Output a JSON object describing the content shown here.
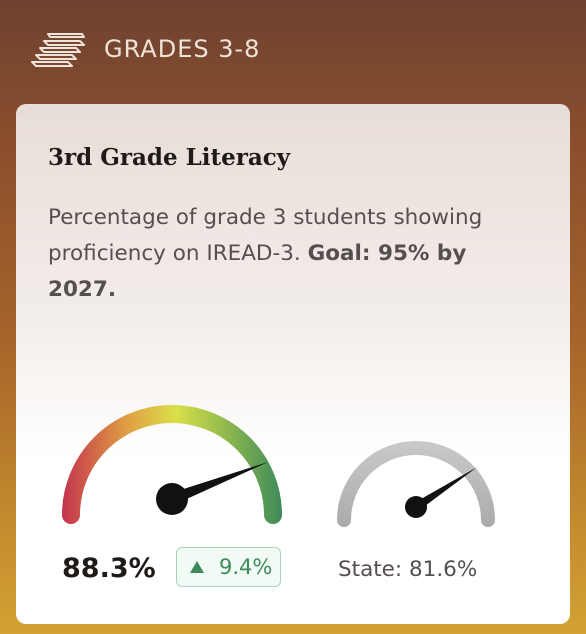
{
  "header": {
    "icon": "stairs-icon",
    "title": "GRADES 3-8"
  },
  "card": {
    "title": "3rd Grade Literacy",
    "description": "Percentage of grade 3 students showing proficiency on IREAD-3.",
    "goal": "Goal: 95% by 2027.",
    "gauge": {
      "value": 88.3,
      "value_label": "88.3%",
      "change_icon": "triangle-up-icon",
      "change_label": "9.4%",
      "gradient_colors": [
        "#c4334f",
        "#e0a042",
        "#d9e04a",
        "#8fb84e",
        "#3d8b5a"
      ]
    },
    "state": {
      "value": 81.6,
      "label": "State: 81.6%",
      "color": "#b3b3b3"
    },
    "accent_green": "#3d8b5a"
  }
}
